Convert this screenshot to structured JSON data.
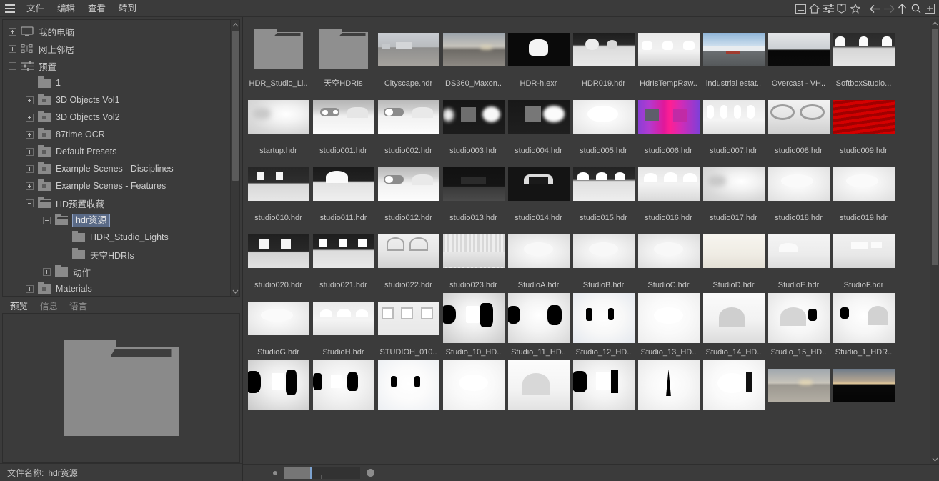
{
  "menubar": {
    "hamburger_icon": "hamburger-menu-icon",
    "items": [
      {
        "label": "文件"
      },
      {
        "label": "编辑"
      },
      {
        "label": "查看"
      },
      {
        "label": "转到"
      }
    ],
    "toolbar_icons": [
      {
        "name": "minimize-panel-icon"
      },
      {
        "name": "home-icon"
      },
      {
        "name": "sliders-icon"
      },
      {
        "name": "bookmark-icon"
      },
      {
        "name": "star-icon"
      },
      {
        "name": "back-arrow-icon"
      },
      {
        "name": "forward-arrow-icon"
      },
      {
        "name": "up-arrow-icon"
      },
      {
        "name": "search-icon"
      },
      {
        "name": "add-box-icon"
      }
    ]
  },
  "tree": {
    "items": [
      {
        "label": "我的电脑",
        "depth": 0,
        "expander": "plus",
        "icon": "computer-icon",
        "selected": false
      },
      {
        "label": "网上邻居",
        "depth": 0,
        "expander": "plus",
        "icon": "network-icon",
        "selected": false
      },
      {
        "label": "预置",
        "depth": 0,
        "expander": "minus",
        "icon": "presets-icon",
        "selected": false
      },
      {
        "label": "1",
        "depth": 1,
        "expander": "none",
        "icon": "folder-icon",
        "selected": false
      },
      {
        "label": "3D Objects Vol1",
        "depth": 1,
        "expander": "plus",
        "icon": "folder-lock-icon",
        "selected": false
      },
      {
        "label": "3D Objects Vol2",
        "depth": 1,
        "expander": "plus",
        "icon": "folder-lock-icon",
        "selected": false
      },
      {
        "label": "87time OCR",
        "depth": 1,
        "expander": "plus",
        "icon": "folder-lock-icon",
        "selected": false
      },
      {
        "label": "Default Presets",
        "depth": 1,
        "expander": "plus",
        "icon": "folder-lock-icon",
        "selected": false
      },
      {
        "label": "Example Scenes - Disciplines",
        "depth": 1,
        "expander": "plus",
        "icon": "folder-lock-icon",
        "selected": false
      },
      {
        "label": "Example Scenes - Features",
        "depth": 1,
        "expander": "plus",
        "icon": "folder-lock-icon",
        "selected": false
      },
      {
        "label": "HD预置收藏",
        "depth": 1,
        "expander": "minus",
        "icon": "folder-open-icon",
        "selected": false
      },
      {
        "label": "hdr资源",
        "depth": 2,
        "expander": "minus",
        "icon": "folder-open-icon",
        "selected": true
      },
      {
        "label": "HDR_Studio_Lights",
        "depth": 3,
        "expander": "none",
        "icon": "folder-icon",
        "selected": false
      },
      {
        "label": "天空HDRIs",
        "depth": 3,
        "expander": "none",
        "icon": "folder-icon",
        "selected": false
      },
      {
        "label": "动作",
        "depth": 2,
        "expander": "plus",
        "icon": "folder-icon",
        "selected": false
      },
      {
        "label": "Materials",
        "depth": 1,
        "expander": "plus",
        "icon": "folder-lock-icon",
        "selected": false
      }
    ],
    "scrollbar": {
      "up_icon": "chevron-up-icon",
      "down_icon": "chevron-down-icon"
    }
  },
  "preview_panel": {
    "tabs": [
      {
        "label": "预览",
        "active": true
      },
      {
        "label": "信息",
        "active": false
      },
      {
        "label": "语言",
        "active": false
      }
    ],
    "preview_icon": "large-folder-icon"
  },
  "statusbar": {
    "label": "文件名称:",
    "value": "hdr资源"
  },
  "filebrowser": {
    "scrollbar": {
      "up_icon": "chevron-up-icon",
      "down_icon": "chevron-down-icon"
    },
    "zoombar": {
      "small_dot_icon": "small-thumbnail-icon",
      "large_dot_icon": "large-thumbnail-icon",
      "slider_name": "thumbnail-size-slider",
      "slider_value": 35
    },
    "items": [
      {
        "label": "HDR_Studio_Li..",
        "kind": "folder"
      },
      {
        "label": "天空HDRIs",
        "kind": "folder"
      },
      {
        "label": "Cityscape.hdr",
        "kind": "image",
        "style": "cityscape"
      },
      {
        "label": "DS360_Maxon..",
        "kind": "image",
        "style": "desert-dusk"
      },
      {
        "label": "HDR-h.exr",
        "kind": "image",
        "style": "black-dome"
      },
      {
        "label": "HDR019.hdr",
        "kind": "image",
        "style": "dome-grey"
      },
      {
        "label": "HdrIsTempRaw..",
        "kind": "image",
        "style": "softbox-row"
      },
      {
        "label": "industrial estat..",
        "kind": "image",
        "style": "mountain-sky"
      },
      {
        "label": "Overcast - VH..",
        "kind": "image",
        "style": "overcast-band"
      },
      {
        "label": "SoftboxStudio...",
        "kind": "image",
        "style": "softbox-dark"
      },
      {
        "label": "startup.hdr",
        "kind": "image",
        "style": "soft-grad-1"
      },
      {
        "label": "studio001.hdr",
        "kind": "image",
        "style": "two-lights"
      },
      {
        "label": "studio002.hdr",
        "kind": "image",
        "style": "one-light"
      },
      {
        "label": "studio003.hdr",
        "kind": "image",
        "style": "dark-box"
      },
      {
        "label": "studio004.hdr",
        "kind": "image",
        "style": "dark-box-2"
      },
      {
        "label": "studio005.hdr",
        "kind": "image",
        "style": "bright-soft"
      },
      {
        "label": "studio006.hdr",
        "kind": "image",
        "style": "magenta"
      },
      {
        "label": "studio007.hdr",
        "kind": "image",
        "style": "pillars"
      },
      {
        "label": "studio008.hdr",
        "kind": "image",
        "style": "rings"
      },
      {
        "label": "studio009.hdr",
        "kind": "image",
        "style": "red-stripes"
      },
      {
        "label": "studio010.hdr",
        "kind": "image",
        "style": "dark-strip"
      },
      {
        "label": "studio011.hdr",
        "kind": "image",
        "style": "dark-dome"
      },
      {
        "label": "studio012.hdr",
        "kind": "image",
        "style": "one-light"
      },
      {
        "label": "studio013.hdr",
        "kind": "image",
        "style": "black-band"
      },
      {
        "label": "studio014.hdr",
        "kind": "image",
        "style": "black-arch"
      },
      {
        "label": "studio015.hdr",
        "kind": "image",
        "style": "light-row"
      },
      {
        "label": "studio016.hdr",
        "kind": "image",
        "style": "light-row-2"
      },
      {
        "label": "studio017.hdr",
        "kind": "image",
        "style": "soft-grad-1"
      },
      {
        "label": "studio018.hdr",
        "kind": "image",
        "style": "soft-grad-2"
      },
      {
        "label": "studio019.hdr",
        "kind": "image",
        "style": "soft-grad-2"
      },
      {
        "label": "studio020.hdr",
        "kind": "image",
        "style": "dark-strip-2"
      },
      {
        "label": "studio021.hdr",
        "kind": "image",
        "style": "dark-strip-3"
      },
      {
        "label": "studio022.hdr",
        "kind": "image",
        "style": "fan-rays"
      },
      {
        "label": "studio023.hdr",
        "kind": "image",
        "style": "grid-lines"
      },
      {
        "label": "StudioA.hdr",
        "kind": "image",
        "style": "pale-dome"
      },
      {
        "label": "StudioB.hdr",
        "kind": "image",
        "style": "pale-dome"
      },
      {
        "label": "StudioC.hdr",
        "kind": "image",
        "style": "pale-dome"
      },
      {
        "label": "StudioD.hdr",
        "kind": "image",
        "style": "cream"
      },
      {
        "label": "StudioE.hdr",
        "kind": "image",
        "style": "pale-flat"
      },
      {
        "label": "StudioF.hdr",
        "kind": "image",
        "style": "pale-block"
      },
      {
        "label": "StudioG.hdr",
        "kind": "image",
        "style": "soft-grad-2"
      },
      {
        "label": "StudioH.hdr",
        "kind": "image",
        "style": "bumps"
      },
      {
        "label": "STUDIOH_010..",
        "kind": "image",
        "style": "white-panels"
      },
      {
        "label": "Studio_10_HD..",
        "kind": "image",
        "style": "black-blob-1"
      },
      {
        "label": "Studio_11_HD..",
        "kind": "image",
        "style": "black-blob-2"
      },
      {
        "label": "Studio_12_HD..",
        "kind": "image",
        "style": "black-bars"
      },
      {
        "label": "Studio_13_HD..",
        "kind": "image",
        "style": "white-soft"
      },
      {
        "label": "Studio_14_HD..",
        "kind": "image",
        "style": "dome-soft"
      },
      {
        "label": "Studio_15_HD..",
        "kind": "image",
        "style": "black-blob-3"
      },
      {
        "label": "Studio_1_HDR..",
        "kind": "image",
        "style": "black-blob-4"
      },
      {
        "label": "",
        "kind": "image",
        "style": "black-blob-5"
      },
      {
        "label": "",
        "kind": "image",
        "style": "black-bars-2"
      },
      {
        "label": "",
        "kind": "image",
        "style": "black-bars-3"
      },
      {
        "label": "",
        "kind": "image",
        "style": "white-soft"
      },
      {
        "label": "",
        "kind": "image",
        "style": "dome-white"
      },
      {
        "label": "",
        "kind": "image",
        "style": "black-blob-6"
      },
      {
        "label": "",
        "kind": "image",
        "style": "spike"
      },
      {
        "label": "",
        "kind": "image",
        "style": "white-arc"
      },
      {
        "label": "",
        "kind": "image",
        "style": "desert-sunset"
      },
      {
        "label": "",
        "kind": "image",
        "style": "sunset-black"
      }
    ]
  },
  "colors": {
    "window_bg": "#3b3b3b",
    "panel_border": "#2d2d2d",
    "text": "#c8c8c8",
    "selection": "#5a6a86",
    "selection_border": "#8fa2c4",
    "folder": "#8f8f8f",
    "scrollbar_thumb": "#5b5b5b",
    "slider_accent": "#7da3d0"
  }
}
